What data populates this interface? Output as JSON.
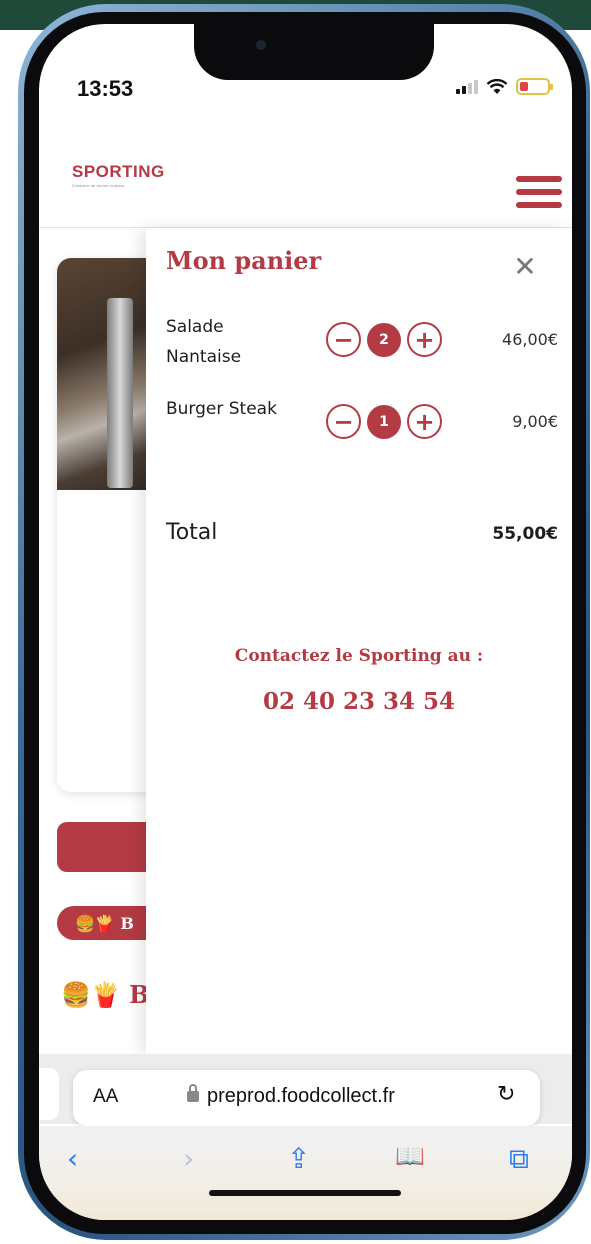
{
  "status_bar": {
    "time": "13:53"
  },
  "header": {
    "logo_text": "SPORTING",
    "logo_tagline": "Créateur de bonne humeur"
  },
  "background_page": {
    "pill_text": "🍔🍟 B",
    "heading_text": "🍔🍟 B"
  },
  "cart": {
    "title": "Mon panier",
    "close_symbol": "✕",
    "items": [
      {
        "name": "Salade Nantaise",
        "quantity": "2",
        "price": "46,00€"
      },
      {
        "name": "Burger Steak",
        "quantity": "1",
        "price": "9,00€"
      }
    ],
    "decrement_symbol": "−",
    "increment_symbol": "+",
    "total_label": "Total",
    "total_value": "55,00€",
    "contact_text": "Contactez le Sporting au :",
    "phone": "02 40 23 34 54"
  },
  "browser": {
    "text_size_label": "AA",
    "url": "preprod.foodcollect.fr",
    "reload_symbol": "↻",
    "back_symbol": "‹",
    "forward_symbol": "›",
    "share_symbol": "⇪",
    "bookmarks_symbol": "📖",
    "tabs_symbol": "⧉"
  },
  "colors": {
    "brand": "#b43a44",
    "safari_blue": "#2d7cf6"
  }
}
